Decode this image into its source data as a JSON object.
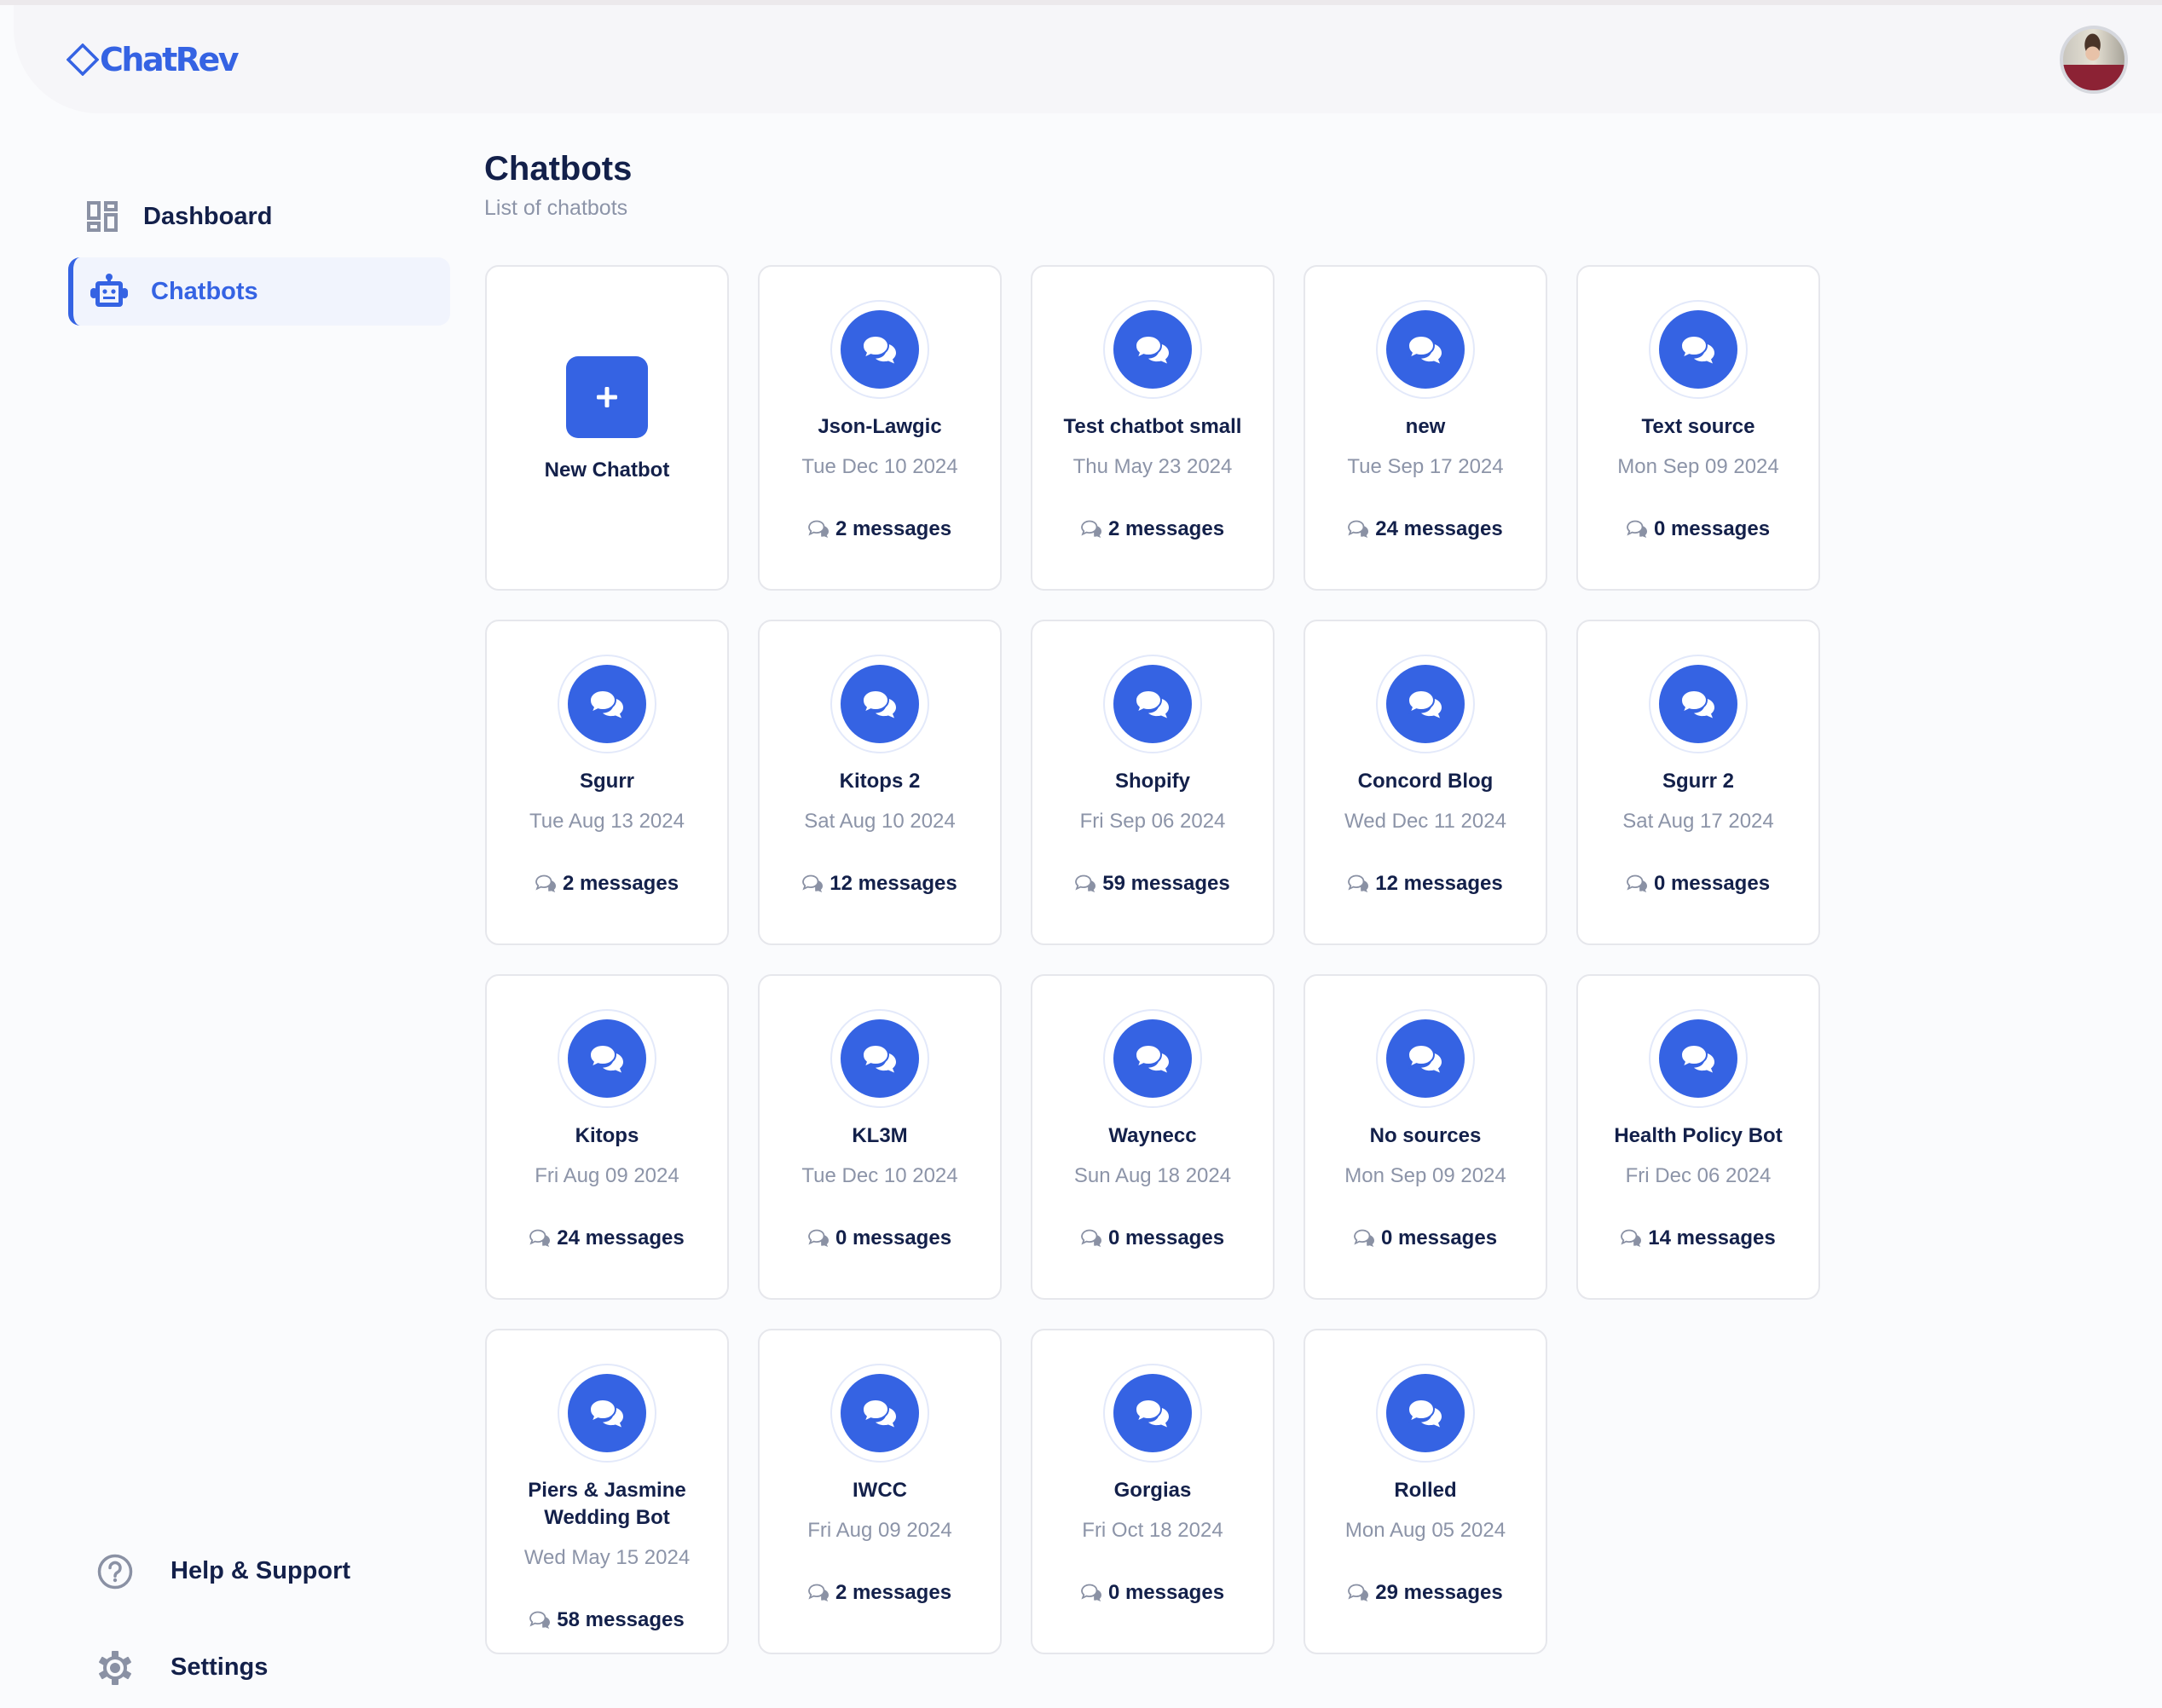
{
  "app": {
    "logo_text": "ChatRev",
    "brand_color": "#3563E3",
    "avatar_alt": "User profile photo"
  },
  "sidebar": {
    "items": [
      {
        "label": "Dashboard",
        "icon": "dashboard-icon",
        "active": false
      },
      {
        "label": "Chatbots",
        "icon": "robot-icon",
        "active": true
      }
    ],
    "bottom_items": [
      {
        "label": "Help & Support",
        "icon": "help-circle-icon"
      },
      {
        "label": "Settings",
        "icon": "gear-icon"
      }
    ]
  },
  "main": {
    "title": "Chatbots",
    "subtitle": "List of chatbots",
    "new_chatbot_label": "New Chatbot",
    "chatbots": [
      {
        "name": "Json-Lawgic",
        "date": "Tue Dec 10 2024",
        "messages": "2 messages"
      },
      {
        "name": "Test chatbot small",
        "date": "Thu May 23 2024",
        "messages": "2 messages"
      },
      {
        "name": "new",
        "date": "Tue Sep 17 2024",
        "messages": "24 messages"
      },
      {
        "name": "Text source",
        "date": "Mon Sep 09 2024",
        "messages": "0 messages"
      },
      {
        "name": "Sgurr",
        "date": "Tue Aug 13 2024",
        "messages": "2 messages"
      },
      {
        "name": "Kitops 2",
        "date": "Sat Aug 10 2024",
        "messages": "12 messages"
      },
      {
        "name": "Shopify",
        "date": "Fri Sep 06 2024",
        "messages": "59 messages"
      },
      {
        "name": "Concord Blog",
        "date": "Wed Dec 11 2024",
        "messages": "12 messages"
      },
      {
        "name": "Sgurr 2",
        "date": "Sat Aug 17 2024",
        "messages": "0 messages"
      },
      {
        "name": "Kitops",
        "date": "Fri Aug 09 2024",
        "messages": "24 messages"
      },
      {
        "name": "KL3M",
        "date": "Tue Dec 10 2024",
        "messages": "0 messages"
      },
      {
        "name": "Waynecc",
        "date": "Sun Aug 18 2024",
        "messages": "0 messages"
      },
      {
        "name": "No sources",
        "date": "Mon Sep 09 2024",
        "messages": "0 messages"
      },
      {
        "name": "Health Policy Bot",
        "date": "Fri Dec 06 2024",
        "messages": "14 messages"
      },
      {
        "name": "Piers & Jasmine Wedding Bot",
        "date": "Wed May 15 2024",
        "messages": "58 messages"
      },
      {
        "name": "IWCC",
        "date": "Fri Aug 09 2024",
        "messages": "2 messages"
      },
      {
        "name": "Gorgias",
        "date": "Fri Oct 18 2024",
        "messages": "0 messages"
      },
      {
        "name": "Rolled",
        "date": "Mon Aug 05 2024",
        "messages": "29 messages"
      }
    ]
  }
}
